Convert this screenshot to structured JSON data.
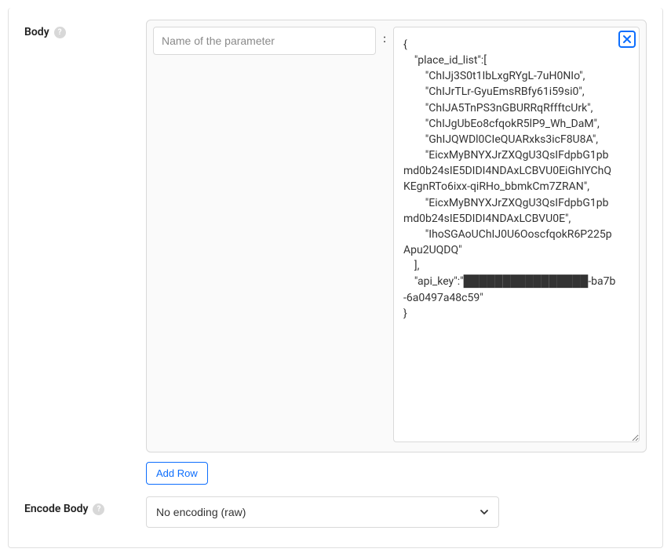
{
  "body": {
    "label": "Body",
    "name_placeholder": "Name of the parameter",
    "name_value": "",
    "value_text": "{\n    \"place_id_list\":[\n        \"ChIJj3S0t1IbLxgRYgL-7uH0NIo\",\n        \"ChIJrTLr-GyuEmsRBfy61i59si0\",\n        \"ChIJA5TnPS3nGBURRqRffftcUrk\",\n        \"ChIJgUbEo8cfqokR5lP9_Wh_DaM\",\n        \"GhIJQWDl0CIeQUARxks3icF8U8A\",\n        \"EicxMyBNYXJrZXQgU3QsIFdpbG1pbmd0b24sIE5DIDI4NDAxLCBVU0EiGhIYChQKEgnRTo6ixx-qiRHo_bbmkCm7ZRAN\",\n        \"EicxMyBNYXJrZXQgU3QsIFdpbG1pbmd0b24sIE5DIDI4NDAxLCBVU0E\",\n        \"IhoSGAoUChIJ0U6OoscfqokR6P225pApu2UQDQ\"\n    ],\n    \"api_key\":\"████████████████-ba7b-6a0497a48c59\"\n}",
    "add_row_label": "Add Row"
  },
  "encode": {
    "label": "Encode Body",
    "selected": "No encoding (raw)"
  }
}
